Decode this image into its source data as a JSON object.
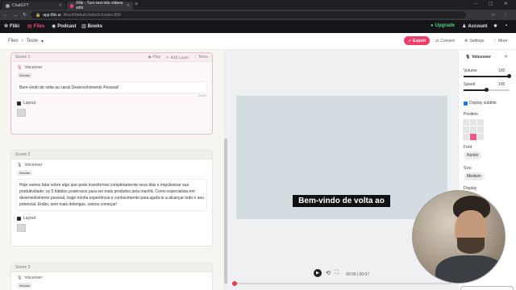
{
  "browser": {
    "tabs": [
      {
        "title": "ChatGPT"
      },
      {
        "title": "Fliki - Turn text into videos with"
      }
    ],
    "url_host": "app.fliki.ai",
    "url_path": "/files/64b6a6c5a5e5c5cbdcc958"
  },
  "app_nav": {
    "logo": "Fliki",
    "files": "Files",
    "podcast": "Podcast",
    "books": "Books",
    "upgrade": "Upgrade",
    "account": "Account"
  },
  "toolbar": {
    "breadcrumb_root": "Files",
    "breadcrumb_current": "Teste",
    "export": "Export",
    "convert": "Convert",
    "settings": "Settings",
    "more": "More"
  },
  "scenes": [
    {
      "title": "Scene 1",
      "actions": {
        "play": "Play",
        "add_layout": "Add Layer",
        "more": "More"
      },
      "voiceover_label": "Voiceover",
      "voice": "Nicolau",
      "text": "Bem-vindo de volta ao canal Desenvolvimento Pessoal!",
      "counter": "0/800",
      "layout_label": "Layout"
    },
    {
      "title": "Scene 2",
      "voiceover_label": "Voiceover",
      "voice": "Nicolau",
      "text": "Hoje vamos falar sobre algo que pode transformar completamente seus dias e impulsionar sua produtividade: os 5 hábitos poderosos para ser mais produtivo pela manhã. Como especialista em desenvolvimento pessoal, trago minha experiência e conhecimento para ajudá-lo a alcançar todo o seu potencial. Então, sem mais delongas, vamos começar!",
      "layout_label": "Layout"
    },
    {
      "title": "Scene 3",
      "voiceover_label": "Voiceover",
      "voice": "Nicolau"
    }
  ],
  "preview": {
    "subtitle": "Bem-vindo de volta ao",
    "time": "00:00 | 00:07"
  },
  "right_panel": {
    "title": "Voiceover",
    "volume_label": "Volume",
    "volume_value": "100",
    "volume_level": 1.0,
    "speed_label": "Speed",
    "speed_value": "100",
    "speed_level": 0.5,
    "display_subtitle": "Display subtitle",
    "position_label": "Position",
    "position_selected": 7,
    "font_label": "Font",
    "font_value": "Nunito",
    "size_label": "Size",
    "size_value": "Medium",
    "display_label": "Display"
  },
  "colors": {
    "accent": "#ec3e6b",
    "upgrade": "#4cd07d"
  }
}
